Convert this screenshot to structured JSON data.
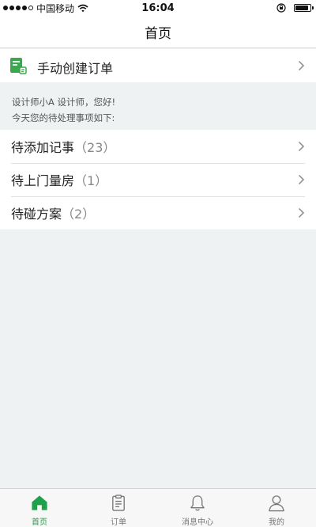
{
  "status_bar": {
    "carrier": "中国移动",
    "time": "16:04",
    "signal_level": 4,
    "signal_max": 5,
    "battery_level": 0.9
  },
  "nav": {
    "title": "首页"
  },
  "create_order": {
    "label": "手动创建订单",
    "icon": "order-document-icon"
  },
  "greeting": {
    "line1": "设计师小A 设计师，您好!",
    "line2": "今天您的待处理事项如下:"
  },
  "tasks": [
    {
      "label": "待添加记事",
      "count": "（23）"
    },
    {
      "label": "待上门量房",
      "count": "（1）"
    },
    {
      "label": "待碰方案",
      "count": "（2）"
    }
  ],
  "tabs": [
    {
      "label": "首页",
      "icon": "home-icon",
      "active": true
    },
    {
      "label": "订单",
      "icon": "clipboard-icon",
      "active": false
    },
    {
      "label": "消息中心",
      "icon": "bell-icon",
      "active": false
    },
    {
      "label": "我的",
      "icon": "user-icon",
      "active": false
    }
  ],
  "colors": {
    "accent": "#1fa04a",
    "background": "#eff2f2",
    "inactive": "#777777"
  }
}
